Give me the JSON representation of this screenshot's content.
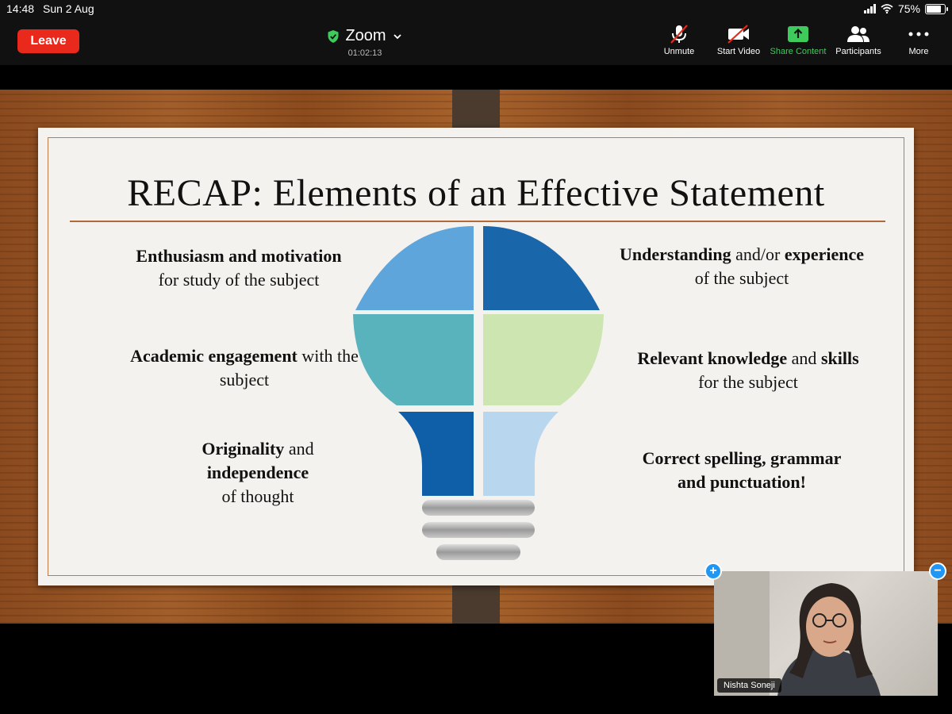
{
  "status_bar": {
    "time": "14:48",
    "date": "Sun 2 Aug",
    "battery": "75%",
    "battery_level": 0.75
  },
  "toolbar": {
    "leave_label": "Leave",
    "meeting_title": "Zoom",
    "elapsed": "01:02:13",
    "buttons": {
      "unmute": "Unmute",
      "start_video": "Start Video",
      "share_content": "Share Content",
      "participants": "Participants",
      "more": "More"
    }
  },
  "slide": {
    "title": "RECAP: Elements of an Effective Statement",
    "left_items": [
      {
        "bold": "Enthusiasm and motivation",
        "rest": "for study of the subject"
      },
      {
        "bold": "Academic engagement",
        "rest": " with the subject"
      },
      {
        "bold1": "Originality",
        "mid": " and ",
        "bold2": "independence",
        "rest": "of thought"
      }
    ],
    "right_items": [
      {
        "bold1": "Understanding",
        "mid": " and/or ",
        "bold2": "experience",
        "rest": " of the subject"
      },
      {
        "bold1": "Relevant knowledge",
        "mid": " and ",
        "bold2": "skills",
        "rest": "for the subject"
      },
      {
        "bold1": "Correct spelling, grammar",
        "bold2": "and punctuation!"
      }
    ],
    "colors": {
      "light_blue": "#5ea5dc",
      "dark_blue": "#1a66aa",
      "teal": "#58b3bd",
      "light_green": "#cde5b0",
      "deep_blue": "#0f5ea8",
      "pale_blue": "#b9d6ef",
      "accent_rule": "#b0693a"
    }
  },
  "self_view": {
    "participant_name": "Nishta Soneji"
  }
}
